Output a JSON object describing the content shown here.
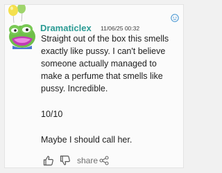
{
  "comment": {
    "username": "Dramaticlex",
    "timestamp": "11/06/25 00:32",
    "paragraphs": [
      "Straight out of the box this smells exactly like pussy. I can't believe someone actually managed to make a perfume that smells like pussy. Incredible.",
      "10/10",
      "Maybe I should call her."
    ],
    "actions": {
      "like_icon": "thumbs-up-outline",
      "dislike_icon": "thumbs-down-outline",
      "share_label": "share",
      "share_icon": "share-nodes"
    },
    "avatar": "green-frog-face",
    "decoration": "balloons"
  },
  "colors": {
    "username": "#2a9a93",
    "balloon_yellow": "#f4e04d",
    "balloon_green": "#9fd56b",
    "avatar_green": "#6fbf4a",
    "avatar_lips": "#c23ab5"
  }
}
